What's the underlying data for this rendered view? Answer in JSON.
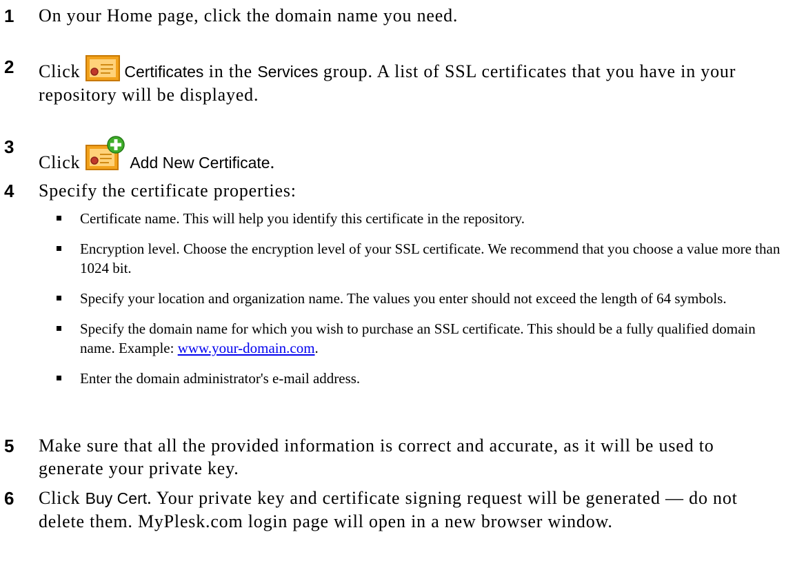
{
  "steps": {
    "s1": {
      "num": "1",
      "text": "On your Home page, click the domain name you need."
    },
    "s2": {
      "num": "2",
      "click": "Click",
      "ui_certificates": "Certificates",
      "in_the": "in the",
      "ui_services": "Services",
      "rest": "group. A list of SSL certificates that you have in your repository will be displayed.",
      "icon": "certificate-icon"
    },
    "s3": {
      "num": "3",
      "click": "Click",
      "ui_add": "Add New Certificate",
      "period": ".",
      "icon": "add-certificate-icon"
    },
    "s4": {
      "num": "4",
      "text": "Specify the certificate properties:",
      "bullets": [
        "Certificate name. This will help you identify this certificate in the repository.",
        "Encryption level. Choose the encryption level of your SSL certificate. We recommend that you choose a value more than 1024 bit.",
        "Specify your location and organization name. The values you enter should not exceed the length of 64 symbols.",
        "Specify the domain name for which you wish to purchase an SSL certificate. This should be a fully qualified domain name. Example:",
        "Enter the domain administrator's e-mail address."
      ],
      "example_link": "www.your-domain.com",
      "example_period": "."
    },
    "s5": {
      "num": "5",
      "text": "Make sure that all the provided information is correct and accurate, as it will be used to generate your private key."
    },
    "s6": {
      "num": "6",
      "click": "Click",
      "ui_buy": "Buy Cert",
      "rest": ". Your private key and certificate signing request will be generated — do not delete them. MyPlesk.com login page will open in a new browser window."
    }
  },
  "colors": {
    "link": "#0000ee",
    "icon_orange": "#f2a21c",
    "icon_plus": "#3fae2a"
  }
}
